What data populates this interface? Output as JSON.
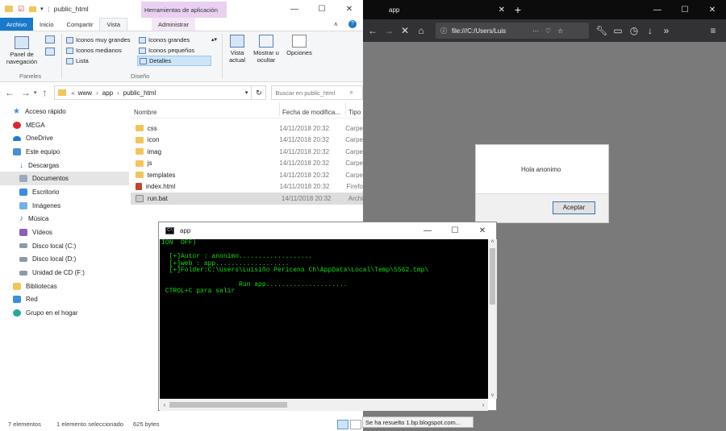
{
  "explorer": {
    "title": "public_html",
    "context_tab": "Herramientas de aplicación",
    "tabs": [
      "Archivo",
      "Inicio",
      "Compartir",
      "Vista",
      "Administrar"
    ],
    "ribbon": {
      "panel_nav": "Panel de navegación",
      "panes_group": "Paneles",
      "layout_group": "Diseño",
      "layouts": [
        "Iconos muy grandes",
        "Iconos grandes",
        "Iconos medianos",
        "Iconos pequeños",
        "Lista",
        "Detalles"
      ],
      "current_view": "Vista actual",
      "show_hide": "Mostrar u ocultar",
      "options": "Opciones"
    },
    "breadcrumb": [
      "www",
      "app",
      "public_html"
    ],
    "search_placeholder": "Buscar en public_html",
    "nav_items": [
      "Acceso rápido",
      "MEGA",
      "OneDrive",
      "Este equipo",
      "Descargas",
      "Documentos",
      "Escritorio",
      "Imágenes",
      "Música",
      "Vídeos",
      "Disco local (C:)",
      "Disco local (D:)",
      "Unidad de CD (F:)",
      "Bibliotecas",
      "Red",
      "Grupo en el hogar"
    ],
    "columns": [
      "Nombre",
      "Fecha de modifica...",
      "Tipo"
    ],
    "files": [
      {
        "name": "css",
        "date": "14/11/2018 20:32",
        "type": "Carpe"
      },
      {
        "name": "icon",
        "date": "14/11/2018 20:32",
        "type": "Carpe"
      },
      {
        "name": "imag",
        "date": "14/11/2018 20:32",
        "type": "Carpe"
      },
      {
        "name": "js",
        "date": "14/11/2018 20:32",
        "type": "Carpe"
      },
      {
        "name": "templates",
        "date": "14/11/2018 20:32",
        "type": "Carpe"
      },
      {
        "name": "index.html",
        "date": "14/11/2018 20:32",
        "type": "Firefo"
      },
      {
        "name": "run.bat",
        "date": "14/11/2018 20:32",
        "type": "Archi"
      }
    ],
    "status": {
      "count": "7 elementos",
      "selected": "1 elemento seleccionado",
      "size": "625 bytes"
    }
  },
  "browser": {
    "tab_title": "app",
    "url": "file:///C:/Users/Luis",
    "dialog_message": "Hola anonimo",
    "dialog_button": "Aceptar",
    "status_tooltip": "Se ha resuelto 1.bp.blogspot.com..."
  },
  "console": {
    "title": "app",
    "text": "ION  OFF)\n\n  [+]Autor : anonimo...................\n  [+]web : app...................\n  [+]Folder:C:\\Users\\Luisiño Pericena Ch\\AppData\\Local\\Temp\\5562.tmp\\\n\n                    Run app.....................\n CTROL+C para salir"
  }
}
